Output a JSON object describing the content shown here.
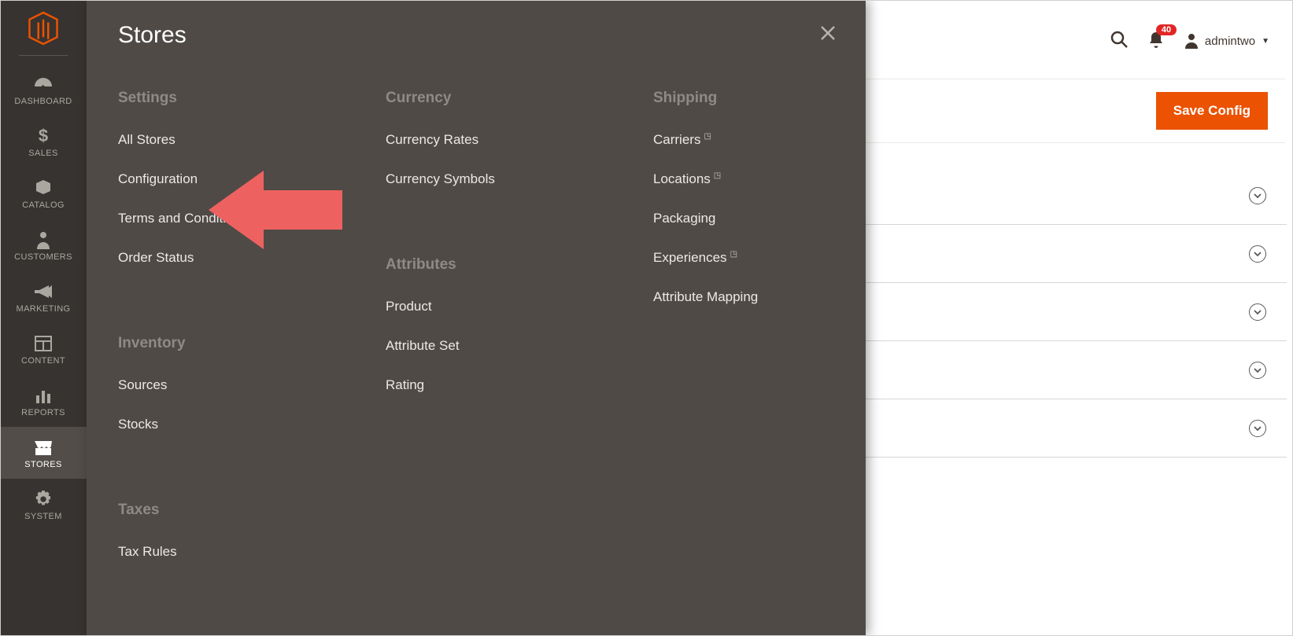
{
  "sidebar": {
    "items": [
      {
        "id": "dashboard",
        "label": "DASHBOARD"
      },
      {
        "id": "sales",
        "label": "SALES"
      },
      {
        "id": "catalog",
        "label": "CATALOG"
      },
      {
        "id": "customers",
        "label": "CUSTOMERS"
      },
      {
        "id": "marketing",
        "label": "MARKETING"
      },
      {
        "id": "content",
        "label": "CONTENT"
      },
      {
        "id": "reports",
        "label": "REPORTS"
      },
      {
        "id": "stores",
        "label": "STORES"
      },
      {
        "id": "system",
        "label": "SYSTEM"
      }
    ],
    "active": "stores"
  },
  "flyout": {
    "title": "Stores",
    "columns": [
      {
        "sections": [
          {
            "heading": "Settings",
            "links": [
              "All Stores",
              "Configuration",
              "Terms and Conditions",
              "Order Status"
            ]
          },
          {
            "heading": "Inventory",
            "links": [
              "Sources",
              "Stocks"
            ]
          },
          {
            "heading": "Taxes",
            "links": [
              "Tax Rules"
            ]
          }
        ]
      },
      {
        "sections": [
          {
            "heading": "Currency",
            "links": [
              "Currency Rates",
              "Currency Symbols"
            ]
          },
          {
            "heading": "Attributes",
            "links": [
              "Product",
              "Attribute Set",
              "Rating"
            ]
          }
        ]
      },
      {
        "sections": [
          {
            "heading": "Shipping",
            "links": [
              "Carriers",
              "Locations",
              "Packaging",
              "Experiences",
              "Attribute Mapping"
            ],
            "external": {
              "Carriers": true,
              "Locations": true,
              "Experiences": true
            }
          }
        ]
      }
    ]
  },
  "header": {
    "notification_count": "40",
    "username": "admintwo"
  },
  "actions": {
    "save_label": "Save Config"
  },
  "panels": {
    "rows": [
      1,
      2,
      3,
      4,
      5
    ]
  },
  "colors": {
    "accent": "#eb5202",
    "sidebar_bg": "#373330",
    "flyout_bg": "#4f4a46",
    "badge": "#e22626",
    "annotation": "#ed6261"
  }
}
